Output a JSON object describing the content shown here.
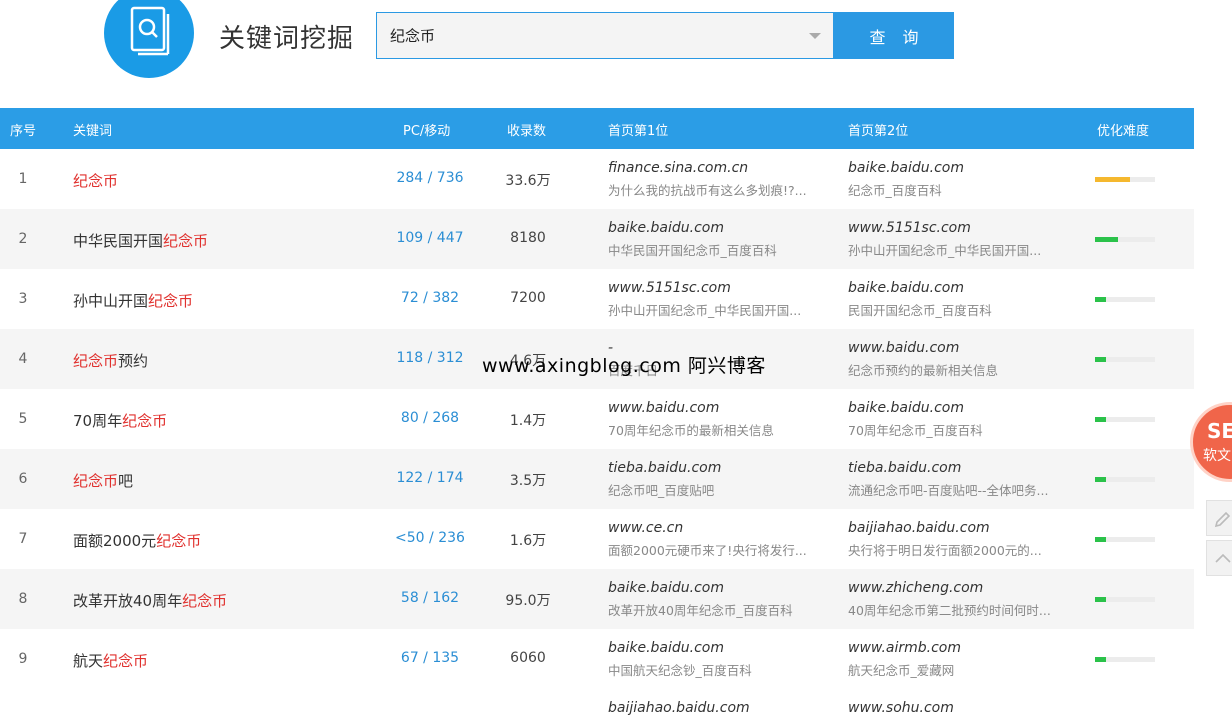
{
  "header": {
    "title": "关键词挖掘",
    "search_value": "纪念币",
    "search_button": "查 询"
  },
  "columns": {
    "idx": "序号",
    "keyword": "关键词",
    "pc_mobile": "PC/移动",
    "indexed": "收录数",
    "rank1": "首页第1位",
    "rank2": "首页第2位",
    "difficulty": "优化难度"
  },
  "rows": [
    {
      "idx": "1",
      "kw_pre": "",
      "kw_hl": "纪念币",
      "kw_post": "",
      "pcm": "284 / 736",
      "count": "33.6万",
      "r1_domain": "finance.sina.com.cn",
      "r1_title": "为什么我的抗战币有这么多划痕!?...",
      "r2_domain": "baike.baidu.com",
      "r2_title": "纪念币_百度百科",
      "difficulty": 0.58,
      "difficulty_color": "#f5b82e"
    },
    {
      "idx": "2",
      "kw_pre": "中华民国开国",
      "kw_hl": "纪念币",
      "kw_post": "",
      "pcm": "109 / 447",
      "count": "8180",
      "r1_domain": "baike.baidu.com",
      "r1_title": "中华民国开国纪念币_百度百科",
      "r2_domain": "www.5151sc.com",
      "r2_title": "孙中山开国纪念币_中华民国开国...",
      "difficulty": 0.38,
      "difficulty_color": "#2bc24a"
    },
    {
      "idx": "3",
      "kw_pre": "孙中山开国",
      "kw_hl": "纪念币",
      "kw_post": "",
      "pcm": "72 / 382",
      "count": "7200",
      "r1_domain": "www.5151sc.com",
      "r1_title": "孙中山开国纪念币_中华民国开国...",
      "r2_domain": "baike.baidu.com",
      "r2_title": "民国开国纪念币_百度百科",
      "difficulty": 0.18,
      "difficulty_color": "#2bc24a"
    },
    {
      "idx": "4",
      "kw_pre": "",
      "kw_hl": "纪念币",
      "kw_post": "预约",
      "pcm": "118 / 312",
      "count": "4.6万",
      "r1_domain": "-",
      "r1_title": "百度千日",
      "r2_domain": "www.baidu.com",
      "r2_title": "纪念币预约的最新相关信息",
      "difficulty": 0.18,
      "difficulty_color": "#2bc24a"
    },
    {
      "idx": "5",
      "kw_pre": "70周年",
      "kw_hl": "纪念币",
      "kw_post": "",
      "pcm": "80 / 268",
      "count": "1.4万",
      "r1_domain": "www.baidu.com",
      "r1_title": "70周年纪念币的最新相关信息",
      "r2_domain": "baike.baidu.com",
      "r2_title": "70周年纪念币_百度百科",
      "difficulty": 0.18,
      "difficulty_color": "#2bc24a"
    },
    {
      "idx": "6",
      "kw_pre": "",
      "kw_hl": "纪念币",
      "kw_post": "吧",
      "pcm": "122 / 174",
      "count": "3.5万",
      "r1_domain": "tieba.baidu.com",
      "r1_title": "纪念币吧_百度贴吧",
      "r2_domain": "tieba.baidu.com",
      "r2_title": "流通纪念币吧-百度贴吧--全体吧务...",
      "difficulty": 0.18,
      "difficulty_color": "#2bc24a"
    },
    {
      "idx": "7",
      "kw_pre": "面额2000元",
      "kw_hl": "纪念币",
      "kw_post": "",
      "pcm": "<50 / 236",
      "count": "1.6万",
      "r1_domain": "www.ce.cn",
      "r1_title": "面额2000元硬币来了!央行将发行...",
      "r2_domain": "baijiahao.baidu.com",
      "r2_title": "央行将于明日发行面额2000元的...",
      "difficulty": 0.18,
      "difficulty_color": "#2bc24a"
    },
    {
      "idx": "8",
      "kw_pre": "改革开放40周年",
      "kw_hl": "纪念币",
      "kw_post": "",
      "pcm": "58 / 162",
      "count": "95.0万",
      "r1_domain": "baike.baidu.com",
      "r1_title": "改革开放40周年纪念币_百度百科",
      "r2_domain": "www.zhicheng.com",
      "r2_title": "40周年纪念币第二批预约时间何时...",
      "difficulty": 0.18,
      "difficulty_color": "#2bc24a"
    },
    {
      "idx": "9",
      "kw_pre": "航天",
      "kw_hl": "纪念币",
      "kw_post": "",
      "pcm": "67 / 135",
      "count": "6060",
      "r1_domain": "baike.baidu.com",
      "r1_title": "中国航天纪念钞_百度百科",
      "r2_domain": "www.airmb.com",
      "r2_title": "航天纪念币_爱藏网",
      "difficulty": 0.18,
      "difficulty_color": "#2bc24a"
    }
  ],
  "partial_row": {
    "r1_domain": "baijiahao.baidu.com",
    "r2_domain": "www.sohu.com"
  },
  "watermark": "www.axingblog.com 阿兴博客",
  "seo_badge": {
    "line1": "SE",
    "line2": "软文"
  }
}
